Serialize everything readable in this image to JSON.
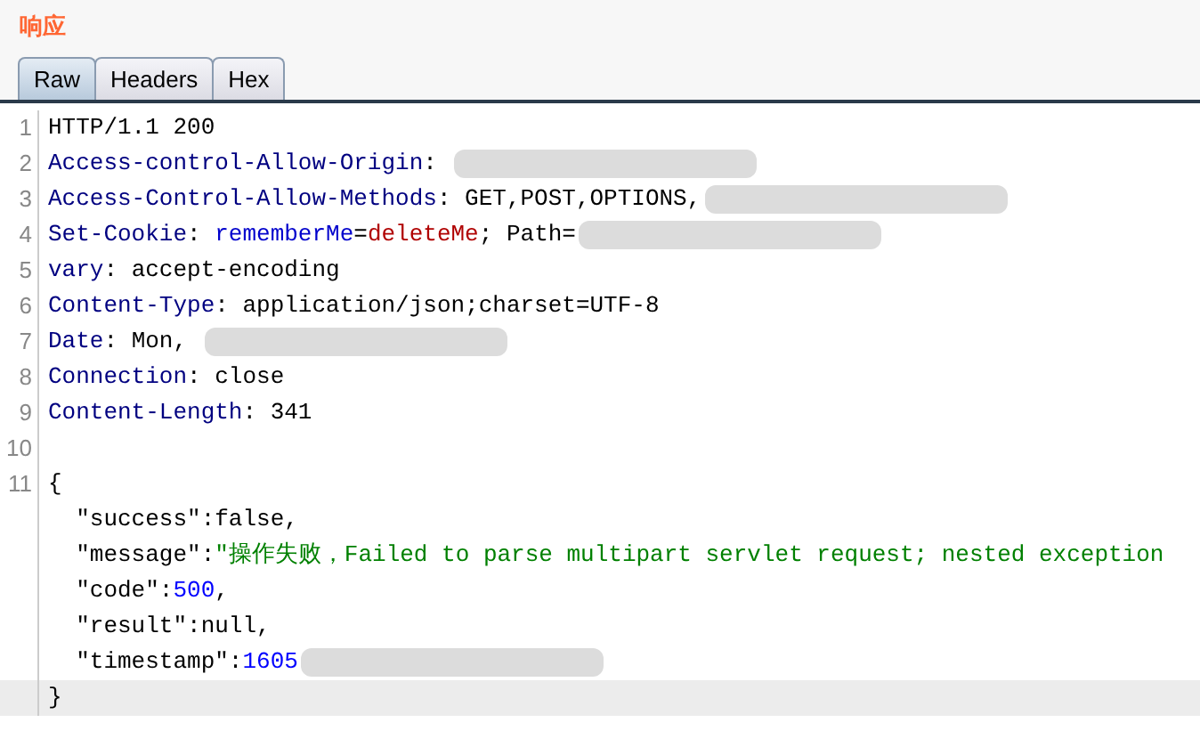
{
  "title": "响应",
  "tabs": [
    {
      "label": "Raw",
      "selected": true
    },
    {
      "label": "Headers",
      "selected": false
    },
    {
      "label": "Hex",
      "selected": false
    }
  ],
  "lines": [
    {
      "number": "1",
      "segments": [
        {
          "kind": "plain",
          "text": "HTTP/1.1 200"
        }
      ]
    },
    {
      "number": "2",
      "segments": [
        {
          "kind": "key",
          "text": "Access-control-Allow-Origin"
        },
        {
          "kind": "plain",
          "text": ": "
        }
      ],
      "redacted": true
    },
    {
      "number": "3",
      "segments": [
        {
          "kind": "key",
          "text": "Access-Control-Allow-Methods"
        },
        {
          "kind": "plain",
          "text": ": GET,POST,OPTIONS,"
        }
      ],
      "redacted": true
    },
    {
      "number": "4",
      "segments": [
        {
          "kind": "key",
          "text": "Set-Cookie"
        },
        {
          "kind": "plain",
          "text": ": "
        },
        {
          "kind": "name",
          "text": "rememberMe"
        },
        {
          "kind": "plain",
          "text": "="
        },
        {
          "kind": "cookie",
          "text": "deleteMe"
        },
        {
          "kind": "plain",
          "text": "; Path="
        }
      ],
      "redacted": true
    },
    {
      "number": "5",
      "segments": [
        {
          "kind": "key",
          "text": "vary"
        },
        {
          "kind": "plain",
          "text": ": accept-encoding"
        }
      ]
    },
    {
      "number": "6",
      "segments": [
        {
          "kind": "key",
          "text": "Content-Type"
        },
        {
          "kind": "plain",
          "text": ": application/json;charset=UTF-8"
        }
      ]
    },
    {
      "number": "7",
      "segments": [
        {
          "kind": "key",
          "text": "Date"
        },
        {
          "kind": "plain",
          "text": ": Mon, "
        }
      ],
      "redacted": true
    },
    {
      "number": "8",
      "segments": [
        {
          "kind": "key",
          "text": "Connection"
        },
        {
          "kind": "plain",
          "text": ": close"
        }
      ]
    },
    {
      "number": "9",
      "segments": [
        {
          "kind": "key",
          "text": "Content-Length"
        },
        {
          "kind": "plain",
          "text": ": 341"
        }
      ]
    },
    {
      "number": "10"
    },
    {
      "number": "11",
      "segments": [
        {
          "kind": "plain",
          "text": "{"
        }
      ]
    },
    {
      "segments": [
        {
          "kind": "plain",
          "text": "  \"success\":false,"
        }
      ]
    },
    {
      "segments": [
        {
          "kind": "plain",
          "text": "  \"message\":"
        },
        {
          "kind": "string",
          "text": "\"操作失败，Failed to parse multipart servlet request; nested exception"
        }
      ]
    },
    {
      "segments": [
        {
          "kind": "plain",
          "text": "  \"code\":"
        },
        {
          "kind": "number",
          "text": "500"
        },
        {
          "kind": "plain",
          "text": ","
        }
      ]
    },
    {
      "segments": [
        {
          "kind": "plain",
          "text": "  \"result\":null,"
        }
      ]
    },
    {
      "segments": [
        {
          "kind": "plain",
          "text": "  \"timestamp\":"
        },
        {
          "kind": "number",
          "text": "1605"
        }
      ],
      "redacted": true
    },
    {
      "segments": [
        {
          "kind": "plain",
          "text": "}"
        }
      ],
      "current": true
    }
  ]
}
